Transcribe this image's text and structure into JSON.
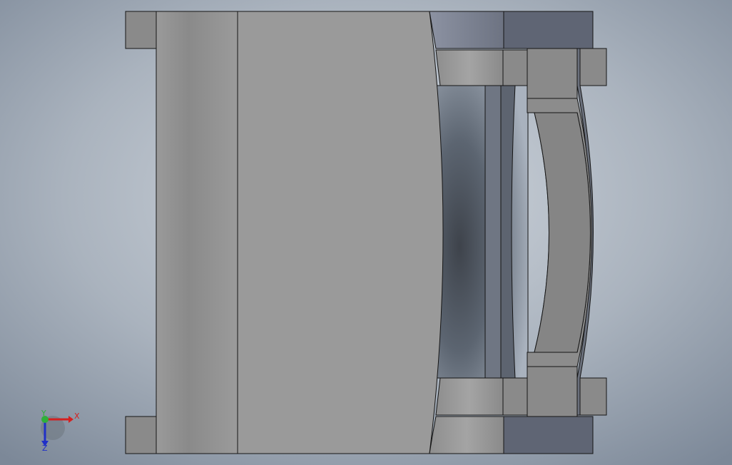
{
  "viewport": {
    "background_top": "#7f8a97",
    "background_bottom": "#c8ced6",
    "part_face_color": "#9a9a9a",
    "part_edge_color": "#1a1a1a",
    "part_dark_face_color": "#5b6472"
  },
  "triad": {
    "x_label": "X",
    "y_label": "Y",
    "z_label": "Z",
    "x_color": "#d42020",
    "y_color": "#2fb03a",
    "z_color": "#2030c8"
  }
}
